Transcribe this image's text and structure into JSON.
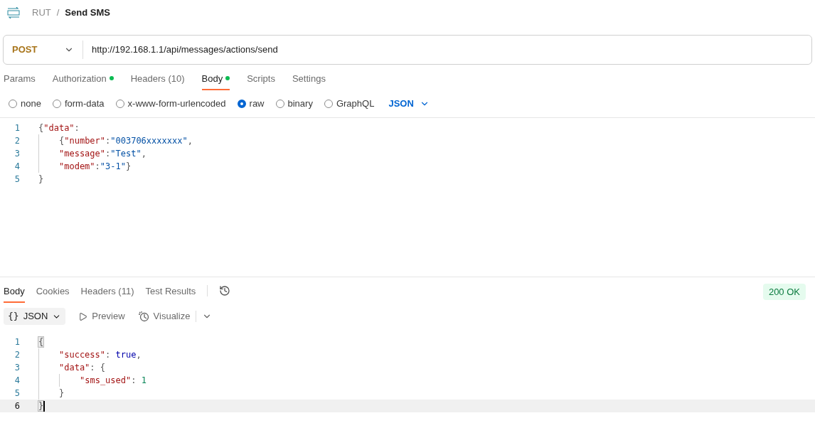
{
  "breadcrumb": {
    "parent": "RUT",
    "separator": "/",
    "title": "Send SMS"
  },
  "request": {
    "method": "POST",
    "url": "http://192.168.1.1/api/messages/actions/send"
  },
  "request_tabs": [
    {
      "label": "Params",
      "selected": false,
      "dot": false
    },
    {
      "label": "Authorization",
      "selected": false,
      "dot": true
    },
    {
      "label": "Headers (10)",
      "selected": false,
      "dot": false
    },
    {
      "label": "Body",
      "selected": true,
      "dot": true
    },
    {
      "label": "Scripts",
      "selected": false,
      "dot": false
    },
    {
      "label": "Settings",
      "selected": false,
      "dot": false
    }
  ],
  "body_types": [
    {
      "label": "none",
      "selected": false
    },
    {
      "label": "form-data",
      "selected": false
    },
    {
      "label": "x-www-form-urlencoded",
      "selected": false
    },
    {
      "label": "raw",
      "selected": true
    },
    {
      "label": "binary",
      "selected": false
    },
    {
      "label": "GraphQL",
      "selected": false
    }
  ],
  "raw_format": "JSON",
  "request_body": [
    {
      "number": "1",
      "tokens": [
        {
          "kind": "punct",
          "text": "{"
        },
        {
          "kind": "key",
          "text": "\"data\""
        },
        {
          "kind": "punct",
          "text": ":"
        }
      ],
      "children": [
        {
          "number": "2",
          "tokens": [
            {
              "kind": "punct",
              "text": "{"
            },
            {
              "kind": "key",
              "text": "\"number\""
            },
            {
              "kind": "punct",
              "text": ":"
            },
            {
              "kind": "string",
              "text": "\"003706xxxxxxx\""
            },
            {
              "kind": "punct",
              "text": ","
            }
          ]
        },
        {
          "number": "3",
          "tokens": [
            {
              "kind": "key",
              "text": "\"message\""
            },
            {
              "kind": "punct",
              "text": ":"
            },
            {
              "kind": "string",
              "text": "\"Test\""
            },
            {
              "kind": "punct",
              "text": ","
            }
          ]
        },
        {
          "number": "4",
          "tokens": [
            {
              "kind": "key",
              "text": "\"modem\""
            },
            {
              "kind": "punct",
              "text": ":"
            },
            {
              "kind": "string",
              "text": "\"3-1\""
            },
            {
              "kind": "punct",
              "text": "}"
            }
          ]
        }
      ]
    },
    {
      "number": "5",
      "tokens": [
        {
          "kind": "punct",
          "text": "}"
        }
      ]
    }
  ],
  "response_tabs": [
    {
      "label": "Body",
      "selected": true
    },
    {
      "label": "Cookies",
      "selected": false
    },
    {
      "label": "Headers (11)",
      "selected": false
    },
    {
      "label": "Test Results",
      "selected": false
    }
  ],
  "status": "200 OK",
  "response_toolbar": {
    "format": "JSON",
    "format_icon": "{}",
    "preview": "Preview",
    "visualize": "Visualize"
  },
  "response_body": [
    {
      "number": "1",
      "current": false,
      "tokens": [
        {
          "kind": "bracket",
          "text": "{"
        }
      ],
      "children": [
        {
          "number": "2",
          "current": false,
          "tokens": [
            {
              "kind": "key",
              "text": "\"success\""
            },
            {
              "kind": "punct",
              "text": ": "
            },
            {
              "kind": "bool",
              "text": "true"
            },
            {
              "kind": "punct",
              "text": ","
            }
          ]
        },
        {
          "number": "3",
          "current": false,
          "tokens": [
            {
              "kind": "key",
              "text": "\"data\""
            },
            {
              "kind": "punct",
              "text": ": "
            },
            {
              "kind": "punct",
              "text": "{"
            }
          ],
          "children": [
            {
              "number": "4",
              "current": false,
              "tokens": [
                {
                  "kind": "key",
                  "text": "\"sms_used\""
                },
                {
                  "kind": "punct",
                  "text": ": "
                },
                {
                  "kind": "number",
                  "text": "1"
                }
              ]
            }
          ]
        },
        {
          "number": "5",
          "current": false,
          "tokens": [
            {
              "kind": "punct",
              "text": "}"
            }
          ]
        }
      ]
    },
    {
      "number": "6",
      "current": true,
      "tokens": [
        {
          "kind": "bracket",
          "text": "}"
        }
      ]
    }
  ]
}
